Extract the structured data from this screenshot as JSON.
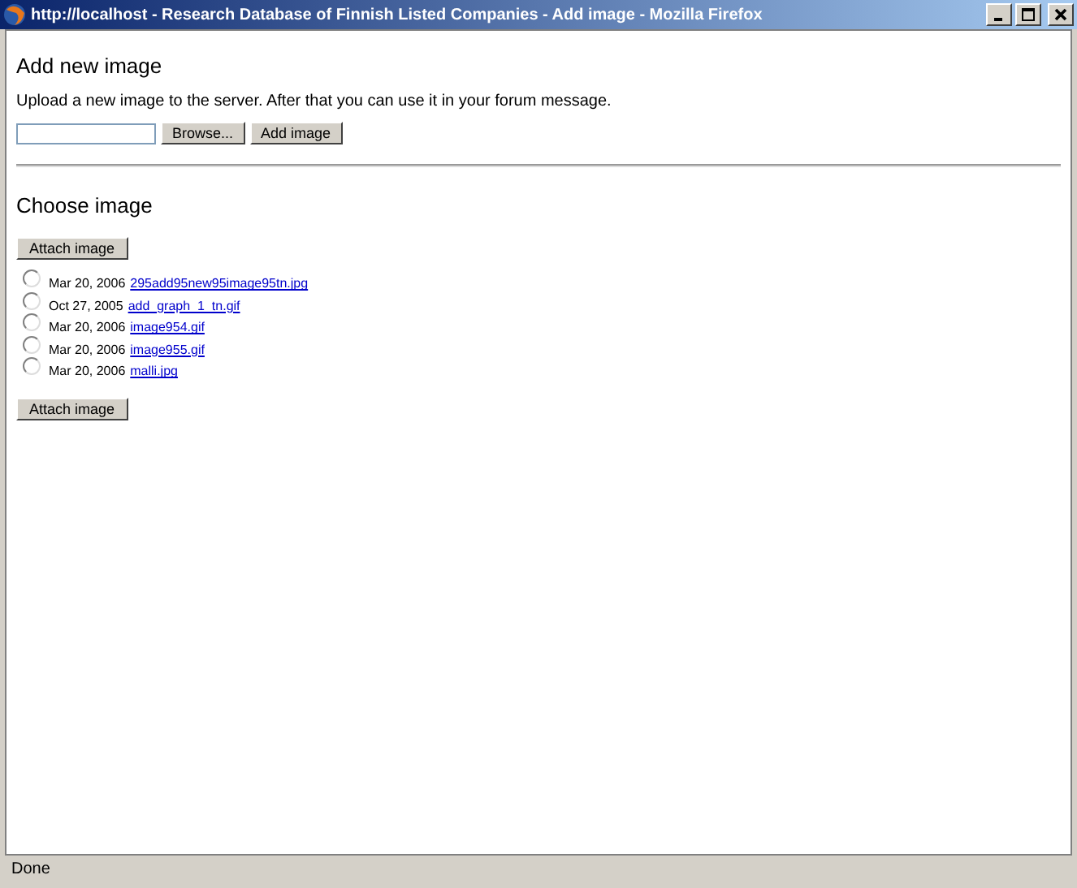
{
  "window": {
    "title": "http://localhost - Research Database of Finnish Listed Companies - Add image - Mozilla Firefox"
  },
  "upload": {
    "heading": "Add new image",
    "description": "Upload a new image to the server. After that you can use it in your forum message.",
    "browse_button": "Browse...",
    "add_button": "Add image"
  },
  "choose": {
    "heading": "Choose image",
    "attach_button_top": "Attach image",
    "attach_button_bottom": "Attach image",
    "images": [
      {
        "date": "Mar 20, 2006",
        "file": "295add95new95image95tn.jpg",
        "selected": false
      },
      {
        "date": "Oct 27, 2005",
        "file": "add_graph_1_tn.gif",
        "selected": false
      },
      {
        "date": "Mar 20, 2006",
        "file": "image954.gif",
        "selected": false
      },
      {
        "date": "Mar 20, 2006",
        "file": "image955.gif",
        "selected": false
      },
      {
        "date": "Mar 20, 2006",
        "file": "malli.jpg",
        "selected": false
      }
    ]
  },
  "status_bar": {
    "text": "Done"
  }
}
